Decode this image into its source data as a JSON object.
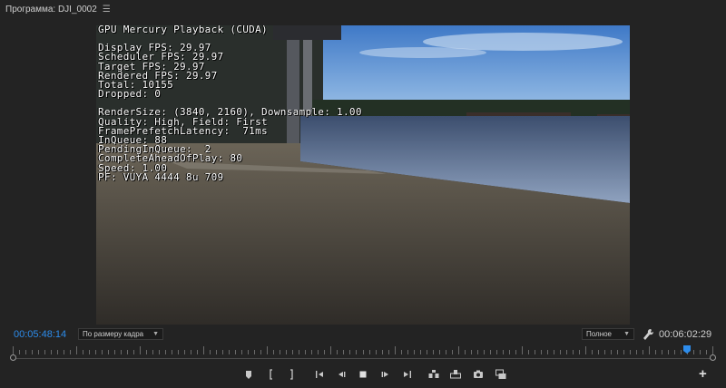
{
  "panel": {
    "title": "Программа: DJI_0002",
    "menu_icon": "hamburger-icon"
  },
  "overlay": {
    "header": "GPU Mercury Playback (CUDA)",
    "stats": [
      "Display FPS: 29.97",
      "Scheduler FPS: 29.97",
      "Target FPS: 29.97",
      "Rendered FPS: 29.97",
      "Total: 10155",
      "Dropped: 0"
    ],
    "details": [
      "RenderSize: (3840, 2160), Downsample: 1.00",
      "Quality: High, Field: First",
      "FramePrefetchLatency:  71ms",
      "InQueue: 88",
      "PendingInQueue:  2",
      "CompleteAheadOfPlay: 80",
      "Speed: 1.00",
      "PF: VUYA 4444 8u 709"
    ]
  },
  "timecode": {
    "current": "00:05:48:14",
    "duration": "00:06:02:29"
  },
  "zoom_select": {
    "value": "По размеру кадра"
  },
  "quality_select": {
    "value": "Полное"
  },
  "icons": {
    "wrench": "wrench-icon",
    "add": "plus-icon"
  },
  "playback": {
    "position_fraction": 0.962
  },
  "colors": {
    "accent": "#2d8ceb",
    "background": "#232323"
  },
  "add_button_label": "+"
}
